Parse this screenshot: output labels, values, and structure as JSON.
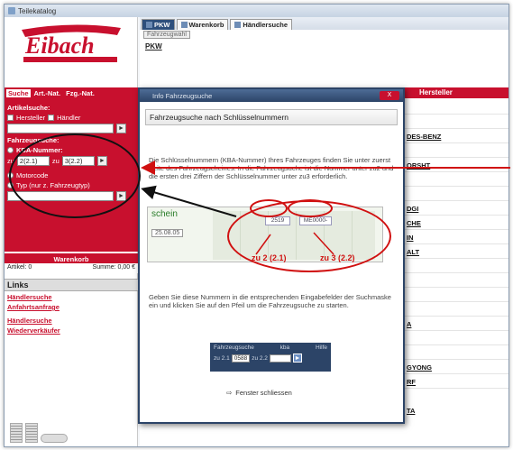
{
  "window": {
    "title": "Teilekatalog"
  },
  "logo": {
    "brand": "Eibach"
  },
  "left": {
    "tabs": [
      "Suche",
      "Art.-Nat.",
      "Fzg.-Nat."
    ],
    "artikelsuche": "Artikelsuche:",
    "hersteller": "Hersteller",
    "haendler": "Händler",
    "fahrzeugsuche": "Fahrzeugsuche:",
    "kba_label": "KBA-Nummer:",
    "zu2_prefix": "zu",
    "zu2_value": "2(2.1)",
    "zu3_prefix": "zu",
    "zu3_value": "3(2.2)",
    "motorcode": "Motorcode",
    "typ": "Typ (nur z. Fahrzeugtyp)",
    "warenkorb": "Warenkorb",
    "artikel": "Artikel: 0",
    "summe": "Summe: 0,00 €",
    "links_header": "Links",
    "links": [
      "Händlersuche",
      "Anfahrtsanfrage",
      "Händlersuche",
      "Wiederverkäufer"
    ]
  },
  "main": {
    "tabs": [
      "PKW",
      "Warenkorb",
      "Händlersuche"
    ],
    "subtab": "Fahrzeugwahl",
    "pkw_link": "PKW",
    "grid_header": "Hersteller",
    "grid_rows": [
      "",
      "",
      "DES-BENZ",
      "",
      "ORSHT",
      "",
      "",
      "DGI",
      "CHE",
      "IN",
      "ALT",
      "",
      "",
      "",
      "",
      "A",
      "",
      "",
      "GYONG",
      "RF",
      "",
      "TA",
      "",
      "",
      ""
    ]
  },
  "modal": {
    "title": "Info Fahrzeugsuche",
    "close": "X",
    "heading": "Fahrzeugsuche nach Schlüsselnummern",
    "text1": "Die Schlüsselnummern (KBA-Nummer) Ihres Fahrzeuges finden Sie unter zuerst Seite des Fahrzeugscheines. In die Fahrzeugsuche ist die Nummer unter zu2 und die ersten drei Ziffern der Schlüsselnummer unter zu3 erforderlich.",
    "doc_label": "schein",
    "doc_date": "25.08.05",
    "doc_field1": "2519",
    "doc_field2": "ME0000-",
    "anno1": "zu 2 (2.1)",
    "anno2": "zu 3 (2.2)",
    "text2": "Geben Sie diese Nummern in die entsprechenden Eingabefelder der Suchmaske ein und klicken Sie auf den Pfeil um die Fahrzeugsuche zu starten.",
    "widget_title": "Fahrzeugsuche",
    "widget_kba": "kba",
    "widget_hilfe": "Hilfe",
    "widget_zu2": "zu 2.1",
    "widget_zu2_val": "0588",
    "widget_zu3": "zu 2.2",
    "widget_go": "►",
    "close_window": "Fenster schliessen"
  },
  "colors": {
    "brand_red": "#c8102e",
    "dialog_blue": "#2c4467",
    "annotation_red": "#d01010"
  }
}
